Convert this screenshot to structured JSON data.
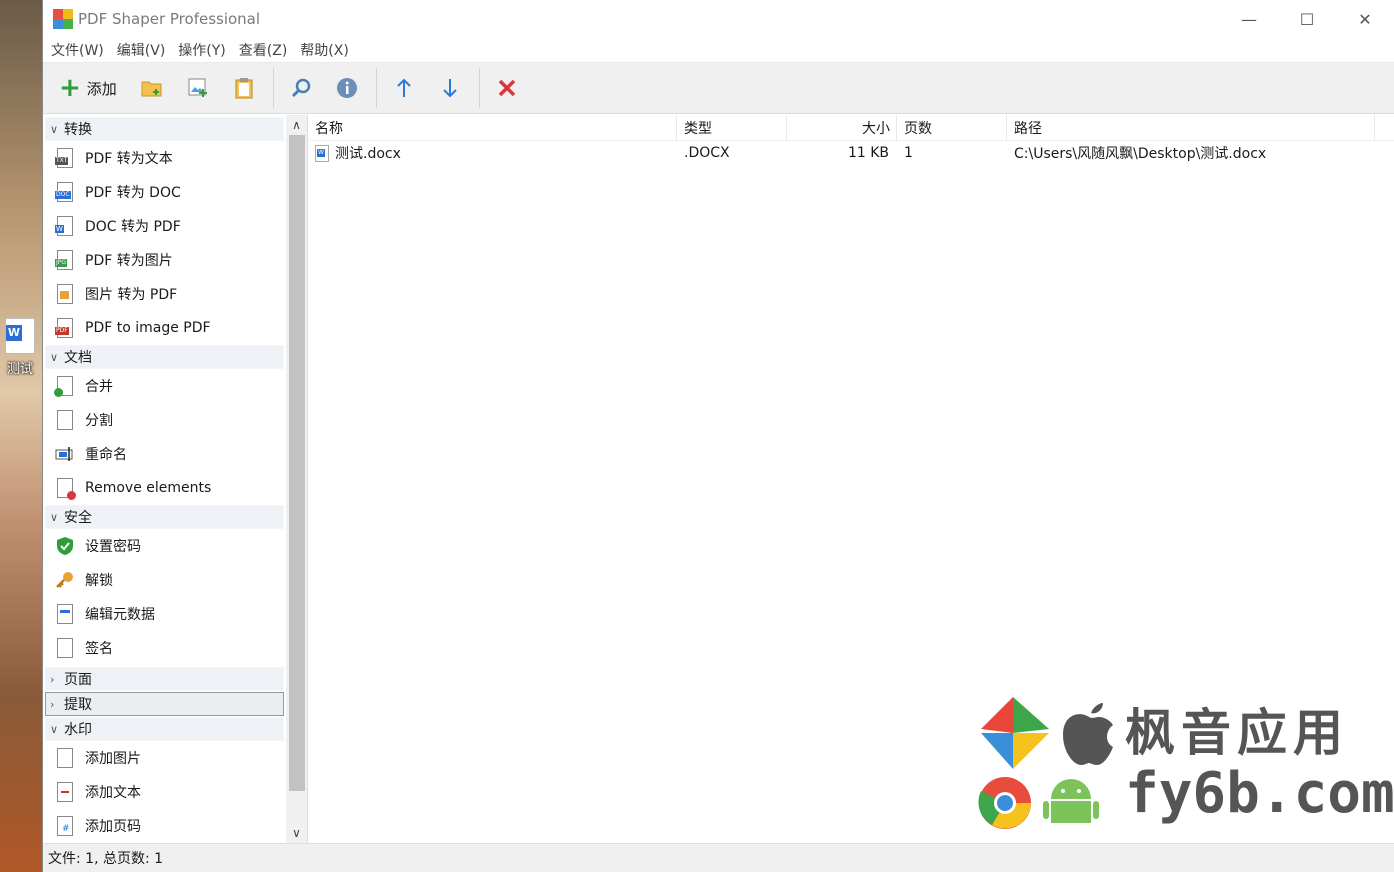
{
  "desktop": {
    "icon_label": "测试"
  },
  "window": {
    "title": "PDF Shaper Professional"
  },
  "menu": [
    "文件(W)",
    "编辑(V)",
    "操作(Y)",
    "查看(Z)",
    "帮助(X)"
  ],
  "toolbar": {
    "add_label": "添加"
  },
  "sidebar": {
    "groups": [
      {
        "label": "转换",
        "expanded": true,
        "items": [
          "PDF 转为文本",
          "PDF 转为 DOC",
          "DOC 转为 PDF",
          "PDF 转为图片",
          "图片 转为 PDF",
          "PDF to image PDF"
        ]
      },
      {
        "label": "文档",
        "expanded": true,
        "items": [
          "合并",
          "分割",
          "重命名",
          "Remove elements"
        ]
      },
      {
        "label": "安全",
        "expanded": true,
        "items": [
          "设置密码",
          "解锁",
          "编辑元数据",
          "签名"
        ]
      },
      {
        "label": "页面",
        "expanded": false,
        "items": []
      },
      {
        "label": "提取",
        "expanded": false,
        "items": []
      },
      {
        "label": "水印",
        "expanded": true,
        "items": [
          "添加图片",
          "添加文本",
          "添加页码"
        ]
      }
    ]
  },
  "table": {
    "columns": [
      "名称",
      "类型",
      "大小",
      "页数",
      "路径"
    ],
    "rows": [
      {
        "name": "测试.docx",
        "type": ".DOCX",
        "size": "11 KB",
        "pages": "1",
        "path": "C:\\Users\\风随风飘\\Desktop\\测试.docx"
      }
    ]
  },
  "status": {
    "text": "文件: 1, 总页数: 1"
  },
  "watermark": {
    "line1": "枫音应用",
    "line2": "fy6b.com"
  },
  "colors": {
    "add_green": "#2f9e3a",
    "delete_red": "#d9363e",
    "arrow_blue": "#2b7bd6"
  }
}
